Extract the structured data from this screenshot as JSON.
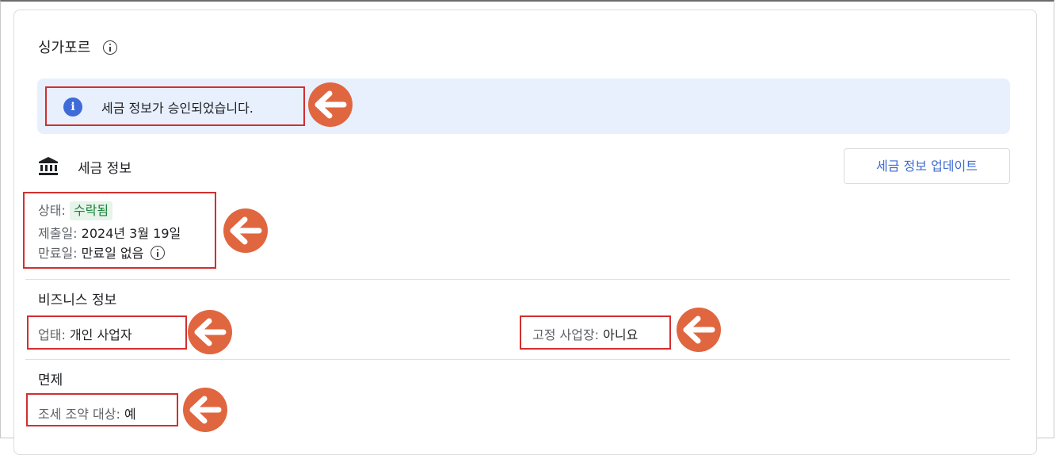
{
  "country": {
    "title": "싱가포르"
  },
  "banner": {
    "message": "세금 정보가 승인되었습니다."
  },
  "tax_info": {
    "title": "세금 정보",
    "update_button": "세금 정보 업데이트",
    "status_label": "상태:",
    "status_value": "수락됨",
    "submitted_label": "제출일:",
    "submitted_value": "2024년 3월 19일",
    "expiry_label": "만료일:",
    "expiry_value": "만료일 없음"
  },
  "business_info": {
    "title": "비즈니스 정보",
    "type_label": "업태:",
    "type_value": "개인 사업자",
    "fixed_place_label": "고정 사업장:",
    "fixed_place_value": "아니요"
  },
  "exemption": {
    "title": "면제",
    "treaty_label": "조세 조약 대상:",
    "treaty_value": "예"
  },
  "colors": {
    "annotation_red": "#d32f2f",
    "arrow_fill": "#e06640",
    "banner_bg": "#e8f0fe",
    "accent_blue": "#3c6bd0",
    "status_green": "#188038"
  }
}
